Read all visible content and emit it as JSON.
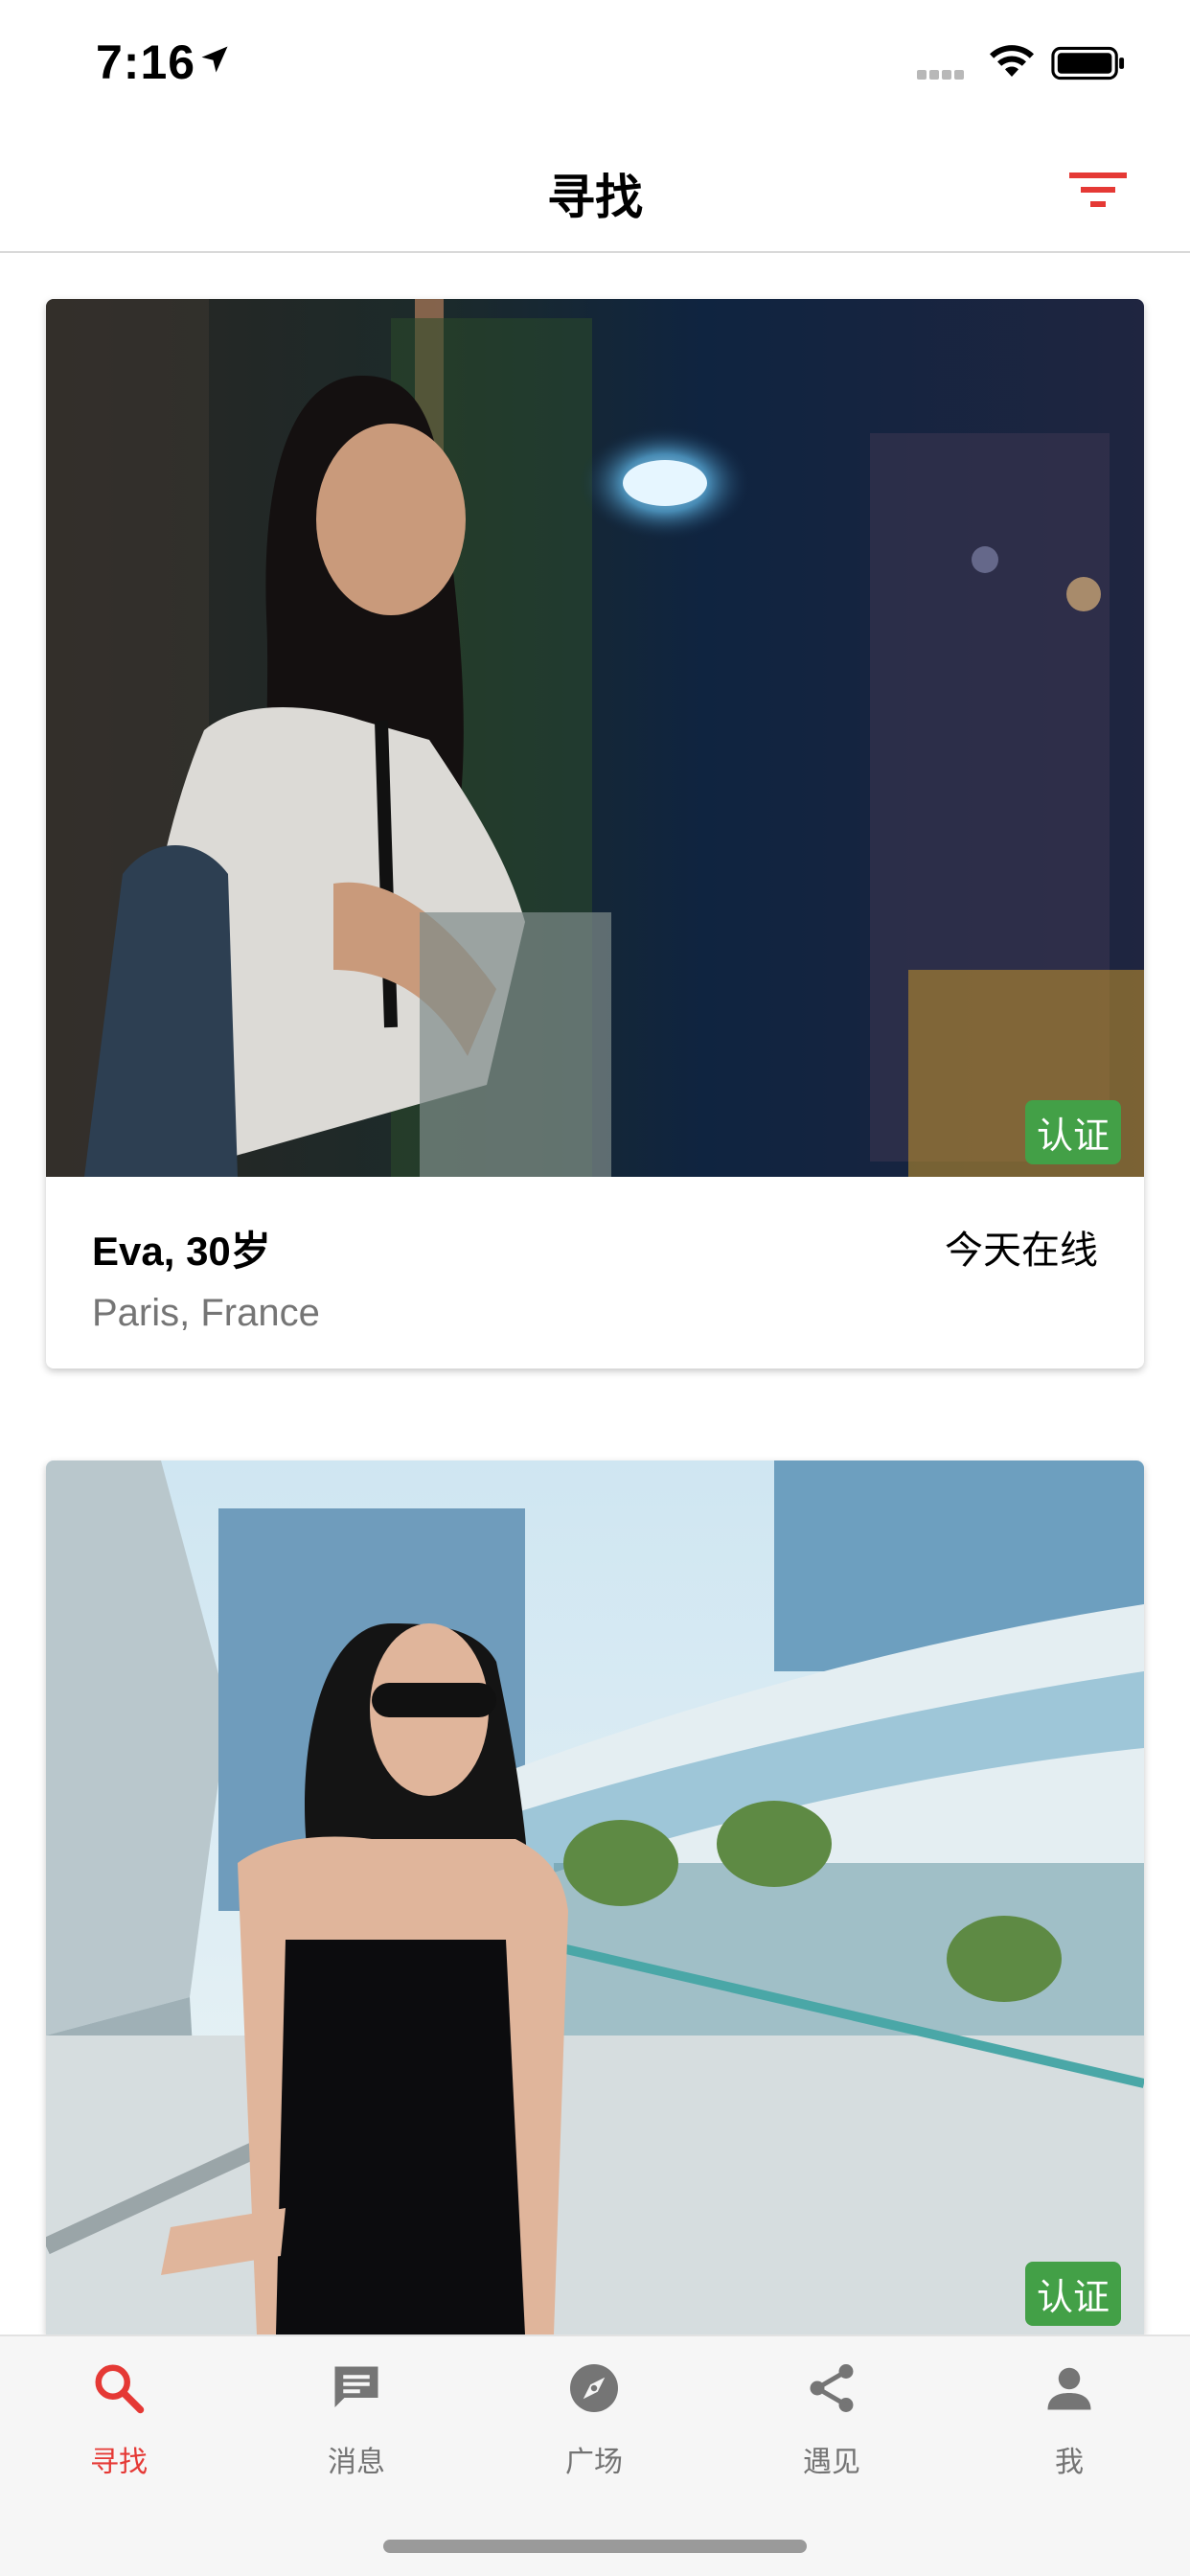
{
  "status_bar": {
    "time": "7:16",
    "icons": [
      "location-arrow-icon",
      "signal-icon",
      "wifi-icon",
      "battery-icon"
    ]
  },
  "nav": {
    "title": "寻找",
    "filter_icon": "filter-icon",
    "accent_color": "#e53935"
  },
  "cards": [
    {
      "name_age": "Eva, 30岁",
      "status": "今天在线",
      "location": "Paris, France",
      "badge": "认证"
    },
    {
      "badge": "认证"
    }
  ],
  "tabs": [
    {
      "label": "寻找",
      "icon": "search-icon",
      "active": true
    },
    {
      "label": "消息",
      "icon": "message-icon",
      "active": false
    },
    {
      "label": "广场",
      "icon": "compass-icon",
      "active": false
    },
    {
      "label": "遇见",
      "icon": "share-icon",
      "active": false
    },
    {
      "label": "我",
      "icon": "person-icon",
      "active": false
    }
  ],
  "colors": {
    "badge": "#43a047",
    "active_tab": "#e53935",
    "inactive_tab": "#737373"
  }
}
